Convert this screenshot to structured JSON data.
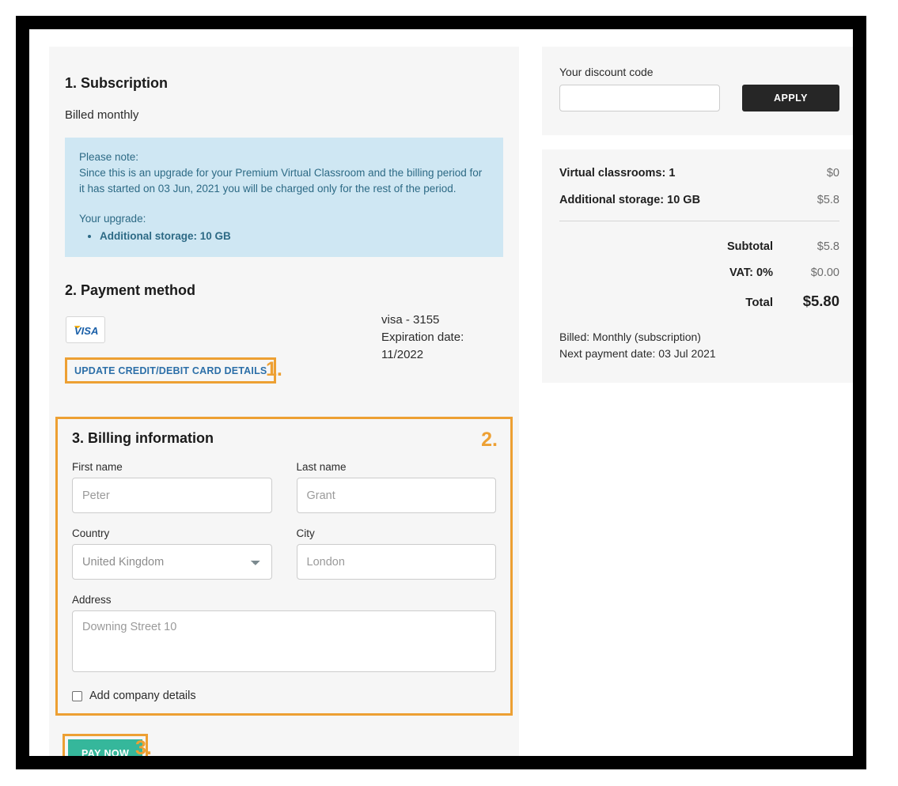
{
  "subscription": {
    "heading": "1. Subscription",
    "billing_cycle": "Billed monthly",
    "notice": {
      "title": "Please note:",
      "body": "Since this is an upgrade for your Premium Virtual Classroom and the billing period for it has started on 03 Jun, 2021 you will be charged only for the rest of the period.",
      "upgrade_label": "Your upgrade:",
      "upgrade_items": [
        "Additional storage: 10 GB"
      ]
    }
  },
  "payment_method": {
    "heading": "2. Payment method",
    "card_brand_logo": "visa-logo",
    "card_summary": "visa - 3155\nExpiration date:\n11/2022",
    "update_card_label": "UPDATE CREDIT/DEBIT CARD DETAILS"
  },
  "billing_information": {
    "heading": "3. Billing information",
    "fields": {
      "first_name": {
        "label": "First name",
        "value": "",
        "placeholder": "Peter"
      },
      "last_name": {
        "label": "Last name",
        "value": "",
        "placeholder": "Grant"
      },
      "country": {
        "label": "Country",
        "selected": "United Kingdom"
      },
      "city": {
        "label": "City",
        "value": "",
        "placeholder": "London"
      },
      "address": {
        "label": "Address",
        "value": "",
        "placeholder": "Downing Street 10"
      }
    },
    "company_checkbox_label": "Add company details"
  },
  "actions": {
    "pay_now_label": "PAY NOW"
  },
  "annotations": {
    "step1": "1.",
    "step2": "2.",
    "step3": "3."
  },
  "discount": {
    "label": "Your discount code",
    "value": "",
    "placeholder": "",
    "apply_label": "APPLY"
  },
  "summary": {
    "items": [
      {
        "label": "Virtual classrooms: 1",
        "amount": "$0"
      },
      {
        "label": "Additional storage: 10 GB",
        "amount": "$5.8"
      }
    ],
    "totals": [
      {
        "label": "Subtotal",
        "amount": "$5.8"
      },
      {
        "label": "VAT: 0%",
        "amount": "$0.00"
      }
    ],
    "grand_total": {
      "label": "Total",
      "amount": "$5.80"
    },
    "billing_note": "Billed: Monthly (subscription)\nNext payment date: 03 Jul 2021"
  },
  "colors": {
    "highlight": "#eda033",
    "pay_now": "#35b79b",
    "apply": "#262626",
    "notice_bg": "#cfe7f3",
    "link": "#2c6fa8"
  }
}
